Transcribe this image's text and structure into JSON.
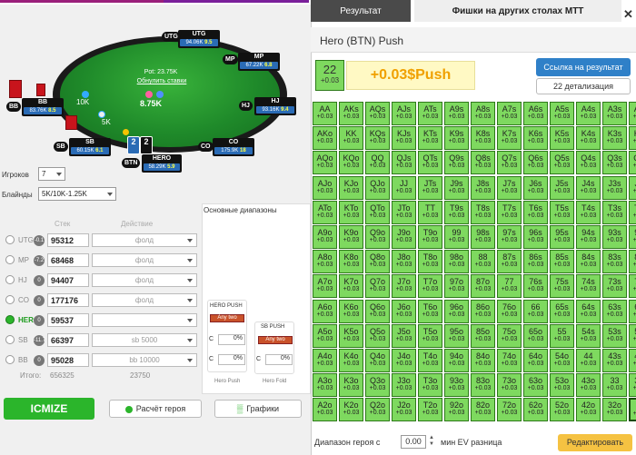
{
  "table": {
    "pot": "Pot: 23.75K",
    "reset": "Обнулить ставки",
    "hero_bet": "8.75K",
    "stake_10k": "10K",
    "stake_5k": "5K",
    "players": {
      "utg": {
        "pos": "UTG",
        "name": "UTG",
        "stack": "94.06K",
        "bb": "9.5"
      },
      "mp": {
        "pos": "MP",
        "name": "MP",
        "stack": "67.22K",
        "bb": "6.8"
      },
      "hj": {
        "pos": "HJ",
        "name": "HJ",
        "stack": "93.16K",
        "bb": "9.4"
      },
      "co": {
        "pos": "CO",
        "name": "CO",
        "stack": "175.9K",
        "bb": "18"
      },
      "btn": {
        "pos": "BTN",
        "name": "HERO",
        "stack": "58.29K",
        "bb": "5.9"
      },
      "sb": {
        "pos": "SB",
        "name": "SB",
        "stack": "60.15K",
        "bb": "6.1"
      },
      "bb": {
        "pos": "BB",
        "name": "BB",
        "stack": "83.76K",
        "bb": "8.5"
      }
    },
    "hero_cards": [
      "2",
      "2"
    ]
  },
  "settings": {
    "players_label": "Игроков",
    "players_value": "7",
    "blinds_label": "Блайнды",
    "blinds_value": "5K/10K-1.25K"
  },
  "seats_header": {
    "stack": "Стек",
    "action": "Действие"
  },
  "seats": [
    {
      "pos": "UTG",
      "badge": "-0.1",
      "stack": "95312",
      "action": "фолд",
      "active": false
    },
    {
      "pos": "MP",
      "badge": "-7.2",
      "stack": "68468",
      "action": "фолд",
      "active": false
    },
    {
      "pos": "HJ",
      "badge": "0",
      "stack": "94407",
      "action": "фолд",
      "active": false
    },
    {
      "pos": "CO",
      "badge": "0",
      "stack": "177176",
      "action": "фолд",
      "active": false
    },
    {
      "pos": "HERO",
      "badge": "0",
      "stack": "59537",
      "action": "",
      "active": true
    },
    {
      "pos": "SB",
      "badge": "-11.7",
      "stack": "66397",
      "action": "sb 5000",
      "active": false
    },
    {
      "pos": "BB",
      "badge": "0",
      "stack": "95028",
      "action": "bb 10000",
      "active": false
    }
  ],
  "totals": {
    "label": "Итого:",
    "stack": "656325",
    "action": "23750"
  },
  "ranges": {
    "tab_label": "Основные диапазоны",
    "hero_push": "HERO PUSH",
    "sb_push": "SB PUSH",
    "any_two": "Any two",
    "c_label": "C",
    "pct": "0%",
    "hero_push_caption": "Hero Push",
    "hero_fold_caption": "Hero Fold"
  },
  "buttons": {
    "icmize": "ICMIZE",
    "calc": "Расчёт героя",
    "graphs": "Графики"
  },
  "result": {
    "tab_result": "Результат",
    "tab_other": "Фишки на других столах МТТ",
    "title": "Hero (BTN) Push",
    "hand_num": "22",
    "hand_ev": "+0.03",
    "summary": "+0.03$Push",
    "link_btn": "Ссылка на результат",
    "detail_btn": "22 детализация",
    "range_label": "Диапазон героя с",
    "range_value": "0.00",
    "range_suffix": "мин EV разница",
    "edit_btn": "Редактировать"
  },
  "grid": {
    "ranks": [
      "A",
      "K",
      "Q",
      "J",
      "T",
      "9",
      "8",
      "7",
      "6",
      "5",
      "4",
      "3",
      "2"
    ],
    "ev": "+0.03",
    "colors": {
      "cell": "#7ed95f",
      "highlight": "#4fc63b",
      "accent": "#2bb52b"
    }
  }
}
